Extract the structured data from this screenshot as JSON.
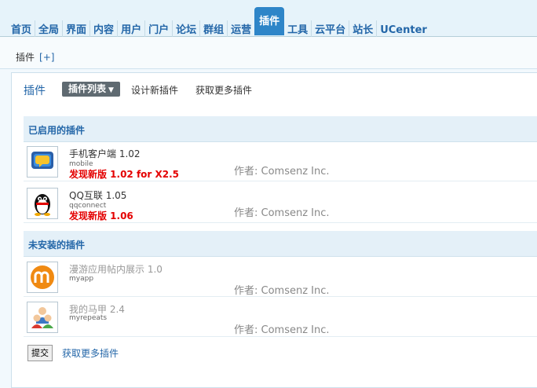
{
  "nav": {
    "tabs": [
      "首页",
      "全局",
      "界面",
      "内容",
      "用户",
      "门户",
      "论坛",
      "群组",
      "运营",
      "插件",
      "工具",
      "云平台",
      "站长",
      "UCenter"
    ],
    "active": "插件"
  },
  "subnav": {
    "crumb": "插件",
    "add": "[+]"
  },
  "page": {
    "title": "插件",
    "dropdown": "插件列表",
    "links": [
      "设计新插件",
      "获取更多插件"
    ]
  },
  "sections": {
    "enabled": "已启用的插件",
    "uninstalled": "未安装的插件"
  },
  "plugins_enabled": [
    {
      "name": "手机客户端 1.02",
      "id": "mobile",
      "update": "发现新版 1.02 for X2.5",
      "author": "作者: Comsenz Inc.",
      "icon": "mobile-chat-icon"
    },
    {
      "name": "QQ互联 1.05",
      "id": "qqconnect",
      "update": "发现新版 1.06",
      "author": "作者: Comsenz Inc.",
      "icon": "qq-penguin-icon"
    }
  ],
  "plugins_uninstalled": [
    {
      "name": "漫游应用帖内展示 1.0",
      "id": "myapp",
      "author": "作者: Comsenz Inc.",
      "icon": "manyou-m-icon"
    },
    {
      "name": "我的马甲 2.4",
      "id": "myrepeats",
      "author": "作者: Comsenz Inc.",
      "icon": "users-icon"
    }
  ],
  "footer": {
    "submit": "提交",
    "more": "获取更多插件"
  },
  "colors": {
    "accent": "#2e85c8",
    "link": "#2366a8",
    "alert": "#e40000"
  }
}
